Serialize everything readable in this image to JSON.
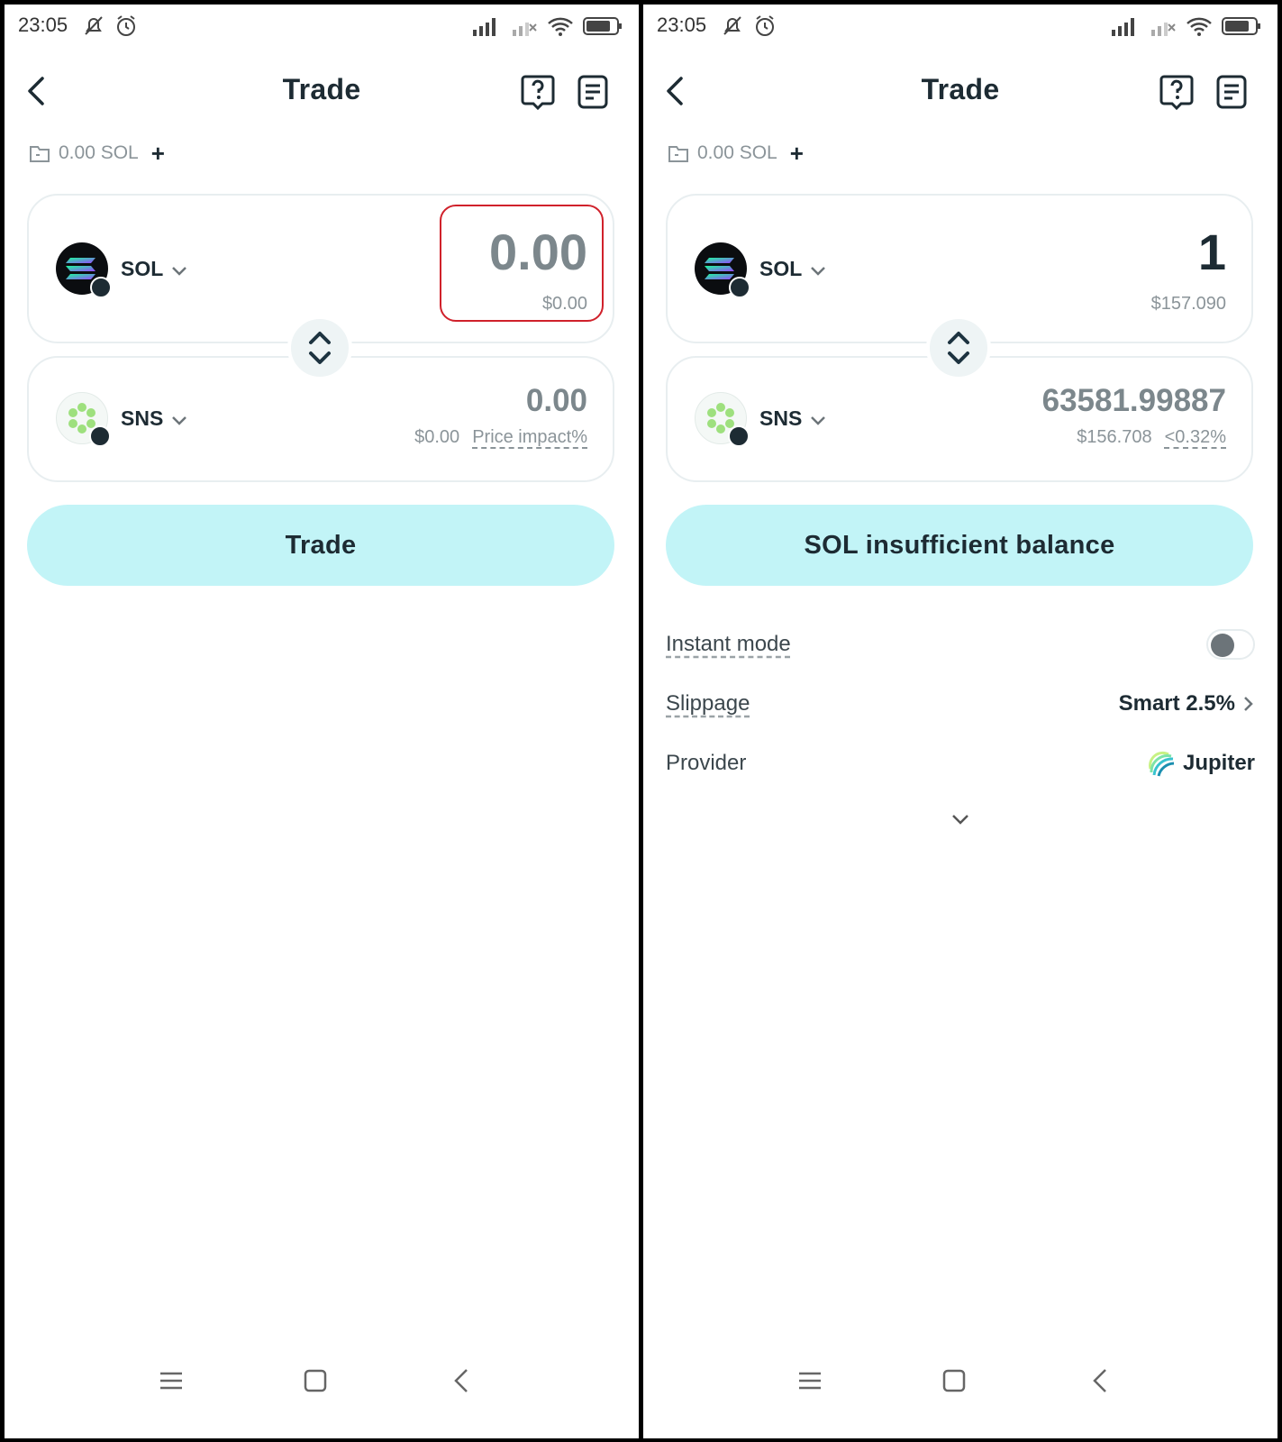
{
  "status_bar": {
    "time": "23:05",
    "battery": "73"
  },
  "left": {
    "title": "Trade",
    "balance": "0.00 SOL",
    "add_label": "+",
    "from": {
      "symbol": "SOL",
      "amount": "0.00",
      "usd": "$0.00"
    },
    "to": {
      "symbol": "SNS",
      "amount": "0.00",
      "usd": "$0.00",
      "impact": "Price impact%"
    },
    "action_label": "Trade"
  },
  "right": {
    "title": "Trade",
    "balance": "0.00 SOL",
    "add_label": "+",
    "from": {
      "symbol": "SOL",
      "amount": "1",
      "usd": "$157.090"
    },
    "to": {
      "symbol": "SNS",
      "amount": "63581.99887",
      "usd": "$156.708",
      "impact": "<0.32%"
    },
    "action_label": "SOL insufficient balance",
    "settings": {
      "instant_mode_label": "Instant mode",
      "instant_mode_on": false,
      "slippage_label": "Slippage",
      "slippage_value": "Smart 2.5%",
      "provider_label": "Provider",
      "provider_value": "Jupiter"
    }
  },
  "icons": {
    "back": "chevron-left-icon",
    "help": "help-bubble-icon",
    "orders": "document-list-icon",
    "wallet": "wallet-icon",
    "swap": "swap-arrows-icon",
    "sol_token": "solana-logo-icon",
    "sns_token": "sns-logo-icon"
  },
  "colors": {
    "primary_button_bg": "#c2f4f7",
    "text_dark": "#1d2b33",
    "text_muted": "#8b9499",
    "highlight": "#d0212b"
  }
}
